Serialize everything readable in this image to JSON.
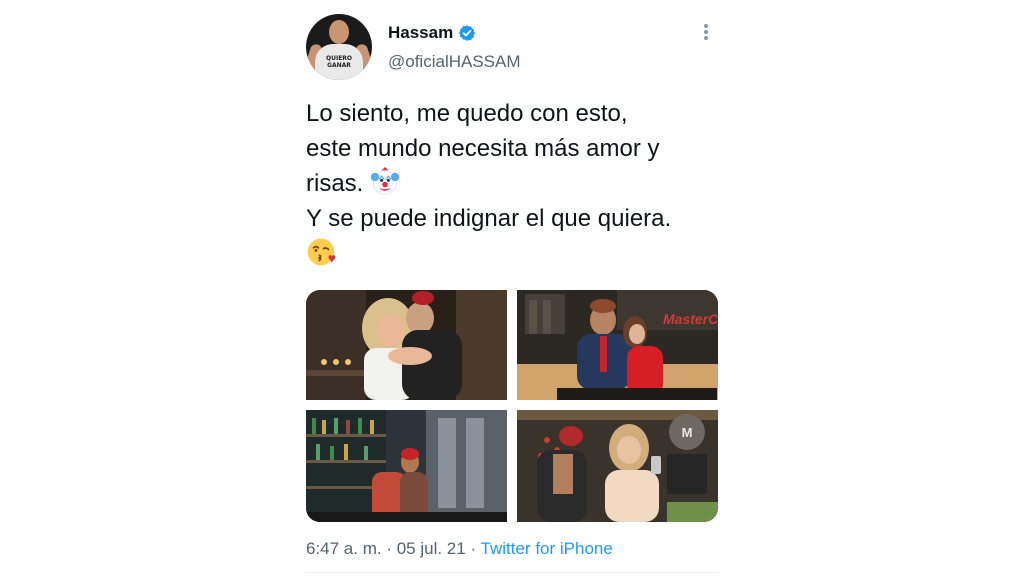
{
  "author": {
    "name": "Hassam",
    "handle": "@oficialHASSAM",
    "avatar_shirt_text": "QUIERO GANAR",
    "verified": true
  },
  "tweet": {
    "lines": [
      "Lo siento, me quedo con esto,",
      "este mundo necesita más amor y",
      "risas.",
      "Y se puede indignar el que quiera."
    ],
    "emojis": [
      "clown-face-emoji",
      "face-blowing-kiss-emoji"
    ],
    "photo_text": "MasterChef"
  },
  "meta": {
    "time": "6:47 a. m.",
    "separator": " · ",
    "date": "05 jul. 21",
    "source": "Twitter for iPhone"
  },
  "colors": {
    "accent": "#1d9bf0",
    "text": "#0f1419",
    "secondary": "#536471"
  }
}
